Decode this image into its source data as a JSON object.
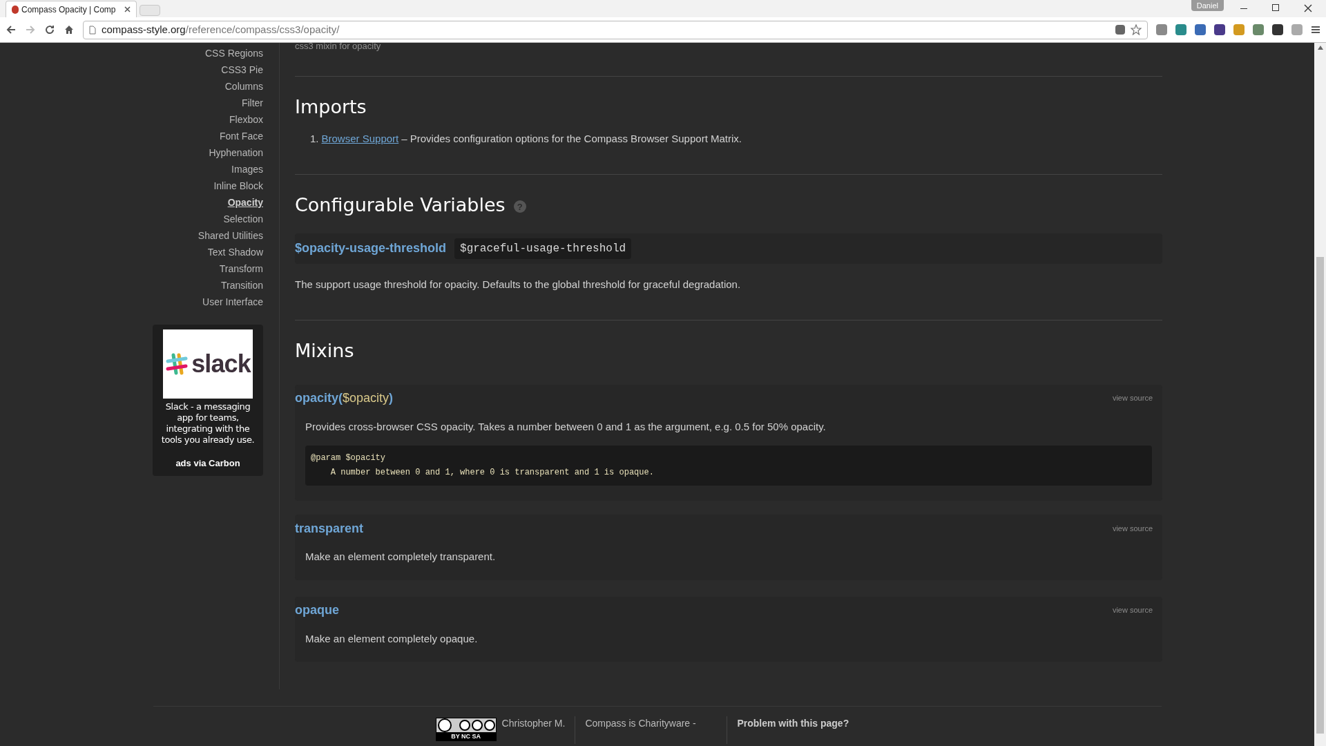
{
  "browser": {
    "tab_title": "Compass Opacity | Comp",
    "url_domain": "compass-style.org",
    "url_path": "/reference/compass/css3/opacity/",
    "profile": "Daniel"
  },
  "sidebar": {
    "items": [
      {
        "label": "CSS Regions",
        "selected": false
      },
      {
        "label": "CSS3 Pie",
        "selected": false
      },
      {
        "label": "Columns",
        "selected": false
      },
      {
        "label": "Filter",
        "selected": false
      },
      {
        "label": "Flexbox",
        "selected": false
      },
      {
        "label": "Font Face",
        "selected": false
      },
      {
        "label": "Hyphenation",
        "selected": false
      },
      {
        "label": "Images",
        "selected": false
      },
      {
        "label": "Inline Block",
        "selected": false
      },
      {
        "label": "Opacity",
        "selected": true
      },
      {
        "label": "Selection",
        "selected": false
      },
      {
        "label": "Shared Utilities",
        "selected": false
      },
      {
        "label": "Text Shadow",
        "selected": false
      },
      {
        "label": "Transform",
        "selected": false
      },
      {
        "label": "Transition",
        "selected": false
      },
      {
        "label": "User Interface",
        "selected": false
      }
    ]
  },
  "ad": {
    "logo_text": "slack",
    "text": "Slack - a messaging app for teams, integrating with the tools you already use.",
    "via": "ads via Carbon"
  },
  "intro": "css3 mixin for opacity",
  "imports": {
    "title": "Imports",
    "items": [
      {
        "number": "1.",
        "link": "Browser Support",
        "description": "– Provides configuration options for the Compass Browser Support Matrix."
      }
    ]
  },
  "variables": {
    "title": "Configurable Variables",
    "help": "?",
    "items": [
      {
        "name": "$opacity-usage-threshold",
        "default": "$graceful-usage-threshold",
        "description": "The support usage threshold for opacity. Defaults to the global threshold for graceful degradation."
      }
    ]
  },
  "mixins": {
    "title": "Mixins",
    "items": [
      {
        "name": "opacity",
        "open": "(",
        "param": "$opacity",
        "close": ")",
        "view_source": "view source",
        "description": "Provides cross-browser CSS opacity. Takes a number between 0 and 1 as the argument, e.g. 0.5 for 50% opacity.",
        "code": [
          "@param $opacity",
          "    A number between 0 and 1, where 0 is transparent and 1 is opaque."
        ]
      },
      {
        "name": "transparent",
        "view_source": "view source",
        "description": "Make an element completely transparent."
      },
      {
        "name": "opaque",
        "view_source": "view source",
        "description": "Make an element completely opaque."
      }
    ]
  },
  "footer": {
    "license": "BY NC SA",
    "author": "Christopher M.",
    "charityware": "Compass is Charityware -",
    "problem": "Problem with this page?"
  }
}
